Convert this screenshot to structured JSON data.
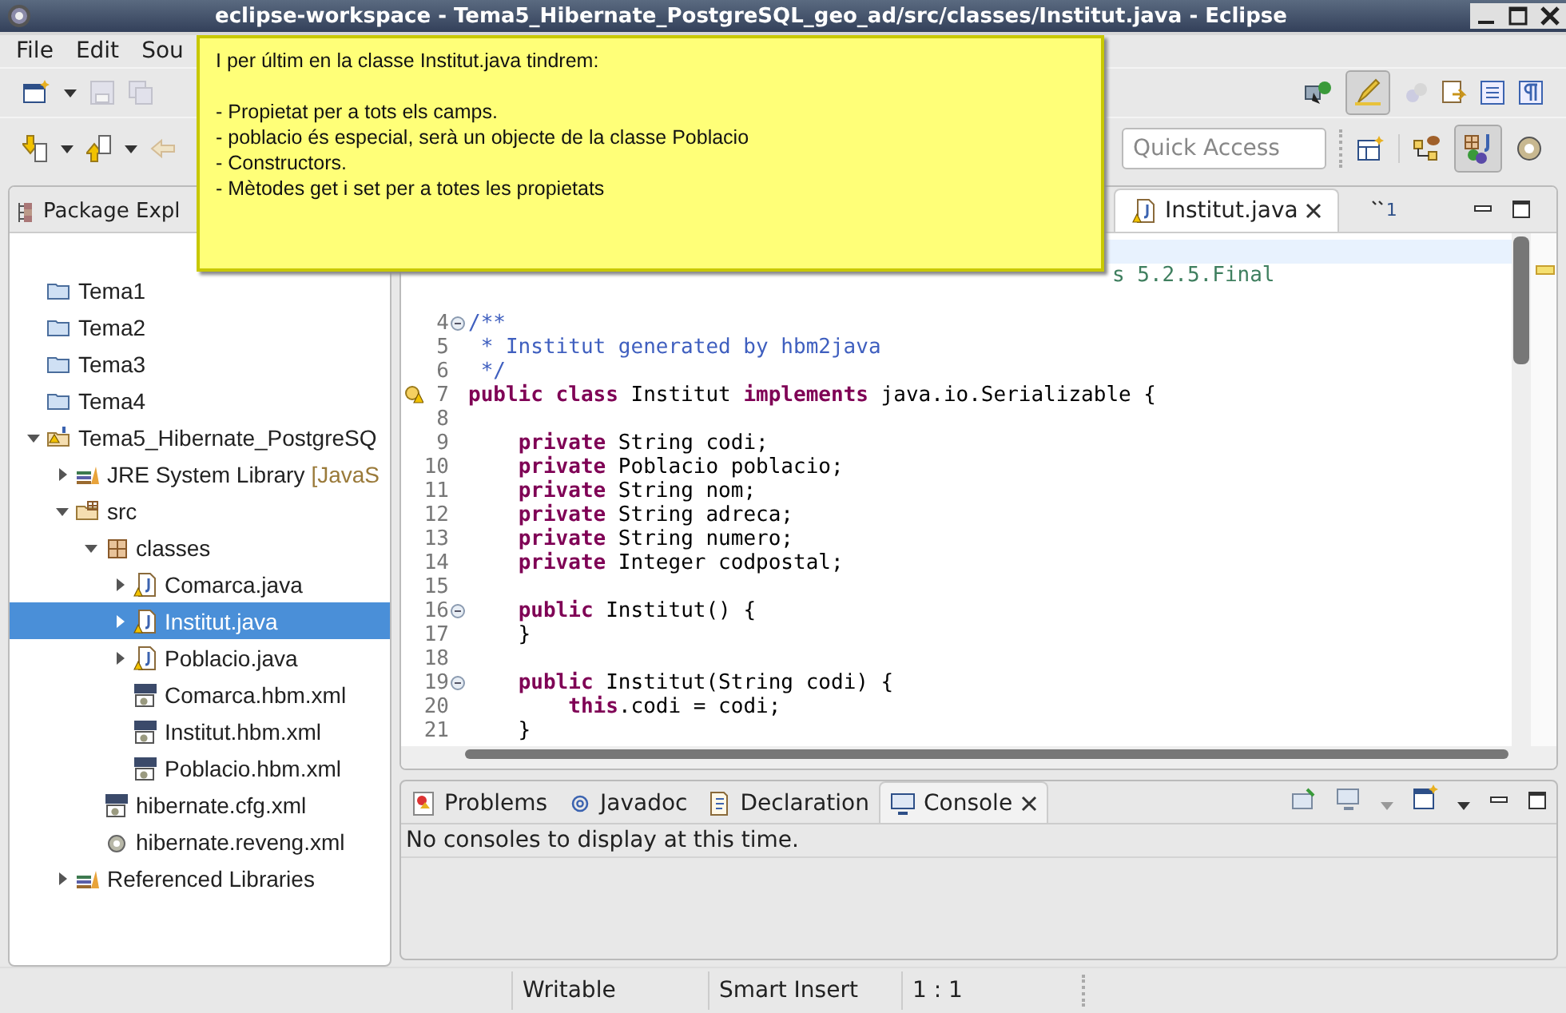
{
  "window": {
    "title": "eclipse-workspace - Tema5_Hibernate_PostgreSQL_geo_ad/src/classes/Institut.java - Eclipse"
  },
  "menu": [
    "File",
    "Edit",
    "Sou"
  ],
  "quick_access": {
    "placeholder": "Quick Access"
  },
  "package_explorer": {
    "title": "Package Expl",
    "tree": [
      {
        "label": "Tema1",
        "kind": "folder",
        "selected": false
      },
      {
        "label": "Tema2",
        "kind": "folder",
        "selected": false
      },
      {
        "label": "Tema3",
        "kind": "folder",
        "selected": false
      },
      {
        "label": "Tema4",
        "kind": "folder",
        "selected": false
      },
      {
        "label": "Tema5_Hibernate_PostgreSQ",
        "kind": "project",
        "selected": false,
        "expanded": true,
        "children": [
          {
            "label": "JRE System Library",
            "decoration": "[JavaS",
            "kind": "library",
            "selected": false,
            "expanded": false
          },
          {
            "label": "src",
            "kind": "srcfolder",
            "selected": false,
            "expanded": true,
            "children": [
              {
                "label": "classes",
                "kind": "package",
                "selected": false,
                "expanded": true,
                "children": [
                  {
                    "label": "Comarca.java",
                    "kind": "java",
                    "selected": false,
                    "expanded": false
                  },
                  {
                    "label": "Institut.java",
                    "kind": "java",
                    "selected": true,
                    "expanded": false
                  },
                  {
                    "label": "Poblacio.java",
                    "kind": "java",
                    "selected": false,
                    "expanded": false
                  },
                  {
                    "label": "Comarca.hbm.xml",
                    "kind": "xml",
                    "selected": false
                  },
                  {
                    "label": "Institut.hbm.xml",
                    "kind": "xml",
                    "selected": false
                  },
                  {
                    "label": "Poblacio.hbm.xml",
                    "kind": "xml",
                    "selected": false
                  }
                ]
              },
              {
                "label": "hibernate.cfg.xml",
                "kind": "xml",
                "selected": false
              },
              {
                "label": "hibernate.reveng.xml",
                "kind": "reveng",
                "selected": false
              }
            ]
          },
          {
            "label": "Referenced Libraries",
            "kind": "library",
            "selected": false,
            "expanded": false
          }
        ]
      }
    ]
  },
  "editor": {
    "tabs": [
      {
        "label": "Institut.java",
        "selected": true
      }
    ],
    "overflow": "1",
    "lines": [
      {
        "current": true
      },
      {
        "current": false,
        "kind": "comment",
        "code": "s 5.2.5.Final"
      },
      {
        "current": false
      },
      {
        "num": "4",
        "current": false,
        "fold": true,
        "kind": "doc",
        "code": "/**"
      },
      {
        "num": "5",
        "current": false,
        "kind": "doc",
        "code": " * Institut generated by hbm2java"
      },
      {
        "num": "6",
        "current": false,
        "kind": "doc",
        "code": " */"
      },
      {
        "num": "7",
        "current": false,
        "warning": true,
        "kind": "code",
        "code": "**public class** Institut **implements** java.io.Serializable {"
      },
      {
        "num": "8",
        "current": false
      },
      {
        "num": "9",
        "current": false,
        "kind": "code",
        "code": "    **private** String codi;"
      },
      {
        "num": "10",
        "current": false,
        "kind": "code",
        "code": "    **private** Poblacio poblacio;"
      },
      {
        "num": "11",
        "current": false,
        "kind": "code",
        "code": "    **private** String nom;"
      },
      {
        "num": "12",
        "current": false,
        "kind": "code",
        "code": "    **private** String adreca;"
      },
      {
        "num": "13",
        "current": false,
        "kind": "code",
        "code": "    **private** String numero;"
      },
      {
        "num": "14",
        "current": false,
        "kind": "code",
        "code": "    **private** Integer codpostal;"
      },
      {
        "num": "15",
        "current": false
      },
      {
        "num": "16",
        "current": false,
        "fold": true,
        "kind": "code",
        "code": "    **public** Institut() {"
      },
      {
        "num": "17",
        "current": false,
        "kind": "code",
        "code": "    }"
      },
      {
        "num": "18",
        "current": false
      },
      {
        "num": "19",
        "current": false,
        "fold": true,
        "kind": "code",
        "code": "    **public** Institut(String codi) {"
      },
      {
        "num": "20",
        "current": false,
        "kind": "code",
        "code": "        **this**.codi = codi;"
      },
      {
        "num": "21",
        "current": false,
        "kind": "code",
        "code": "    }"
      }
    ]
  },
  "bottom_panel": {
    "tabs": [
      {
        "label": "Problems",
        "kind": "problems",
        "selected": false
      },
      {
        "label": "Javadoc",
        "kind": "javadoc",
        "selected": false
      },
      {
        "label": "Declaration",
        "kind": "declaration",
        "selected": false
      },
      {
        "label": "Console",
        "kind": "console",
        "selected": true
      }
    ],
    "message": "No consoles to display at this time."
  },
  "status_bar": [
    "Writable",
    "Smart Insert",
    "1 : 1"
  ],
  "note": {
    "heading": "I per últim en la classe Institut.java tindrem:",
    "lines": [
      "- Propietat per a tots els camps.",
      "- poblacio és especial, serà un objecte de la classe Poblacio",
      "- Constructors.",
      "- Mètodes get i set per a totes les propietats"
    ]
  }
}
